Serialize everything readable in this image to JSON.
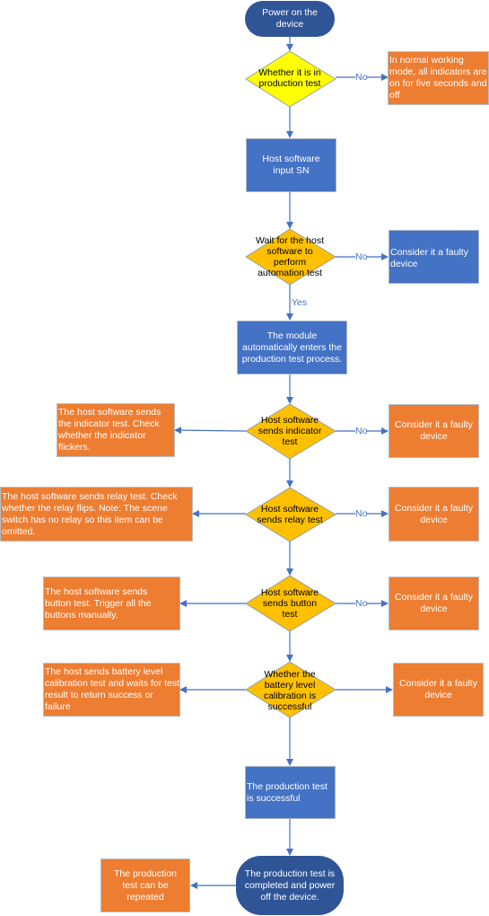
{
  "colors": {
    "terminal": "#2f5597",
    "process_blue": "#4472c4",
    "process_orange": "#ed7d31",
    "decision_yellow": "#ffff00",
    "decision_amber": "#ffc000",
    "connector": "#4472c4"
  },
  "nodes": {
    "start": "Power on the device",
    "d_production_test": "Whether it is in production test",
    "normal_mode": "In normal working mode, all indicators are on for five seconds and off",
    "input_sn": "Host software input SN",
    "d_wait_automation": "Wait for the host software to perform automation test",
    "faulty_1": "Consider it a faulty device",
    "enter_process": "The module automatically enters the production test process.",
    "indicator_desc": "The host software sends the indicator test. Check whether the indicator flickers.",
    "d_indicator": "Host software sends indicator test",
    "faulty_2": "Consider it a faulty device",
    "relay_desc": "The host software sends relay test. Check whether the relay flips. Note: The scene switch has no relay so this item can be omitted.",
    "d_relay": "Host software sends relay test",
    "faulty_3": "Consider it a faulty device",
    "button_desc": "The host software sends button test. Trigger all the buttons manually.",
    "d_button": "Host software sends button test",
    "faulty_4": "Consider it a faulty device",
    "battery_desc": "The host sends battery level calibration test and waits for test result to return success or failure",
    "d_battery": "Whether the battery level calibration is successful",
    "faulty_5": "Consider it a faulty device",
    "success": "The production test is successful",
    "end": "The production test is completed and power off the device.",
    "repeat": "The production test can be repeated"
  },
  "edge_labels": {
    "no_1": "No",
    "no_2": "No",
    "yes_1": "Yes",
    "no_3": "No",
    "no_4": "No",
    "no_5": "No"
  }
}
